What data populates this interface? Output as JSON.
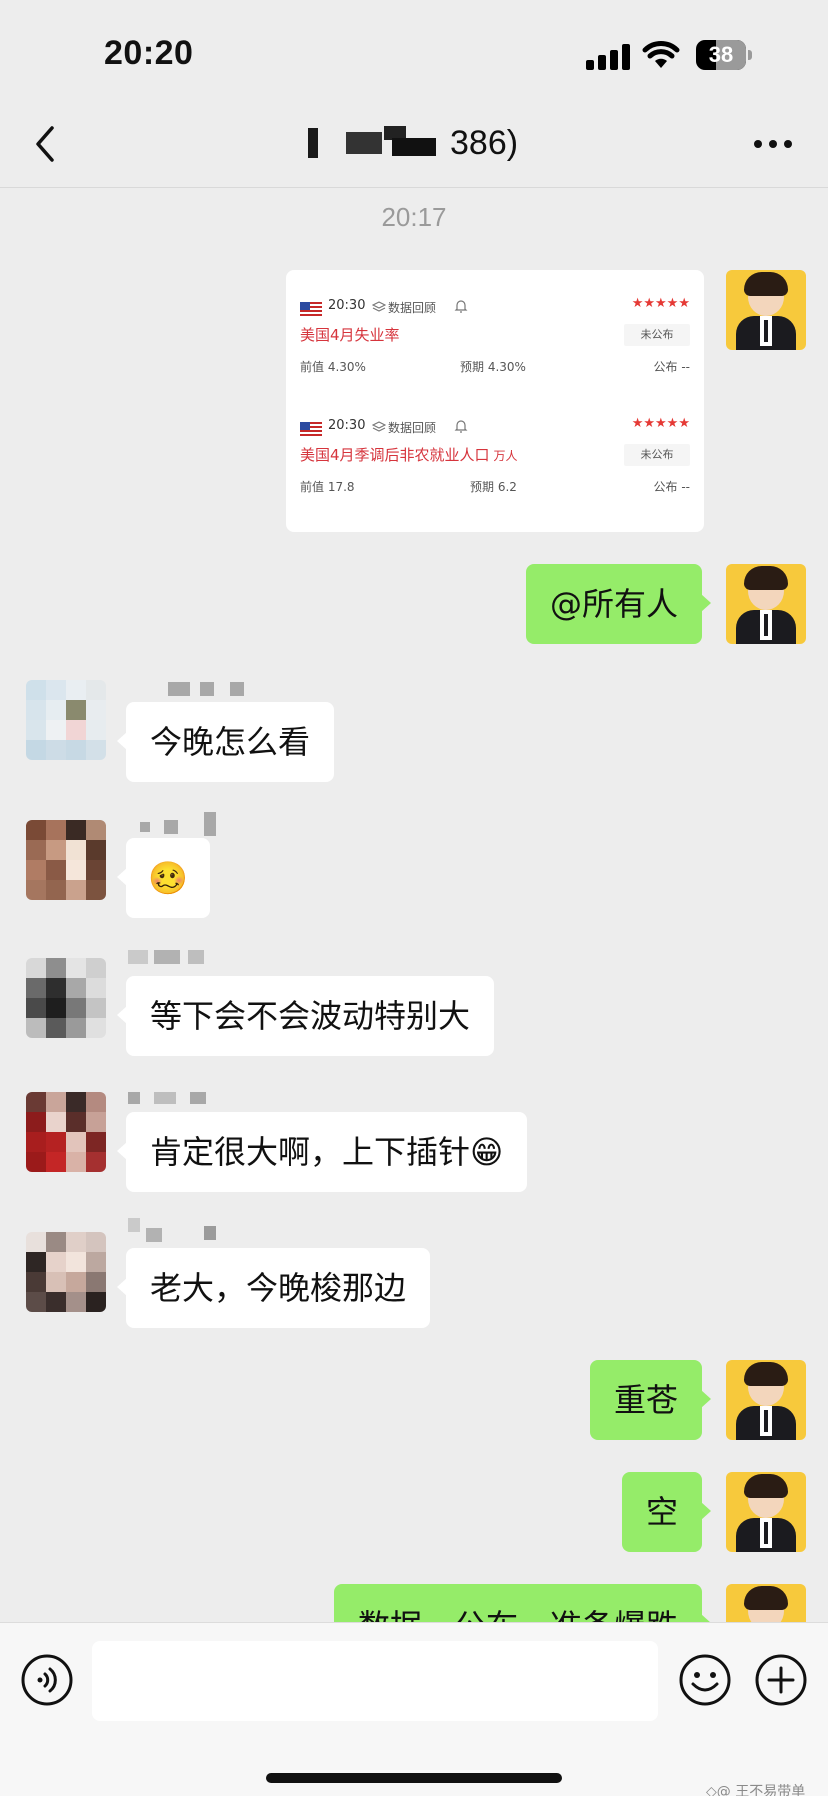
{
  "status_bar": {
    "time": "20:20",
    "battery": "38"
  },
  "nav": {
    "title_visible": "386)"
  },
  "chat": {
    "timestamp": "20:17",
    "data_card": {
      "items": [
        {
          "time": "20:30",
          "tag": "数据回顾",
          "stars": "★★★★★",
          "title": "美国4月失业率",
          "unit": "",
          "status": "未公布",
          "prev": "前值 4.30%",
          "forecast": "预期 4.30%",
          "published": "公布 --"
        },
        {
          "time": "20:30",
          "tag": "数据回顾",
          "stars": "★★★★★",
          "title": "美国4月季调后非农就业人口",
          "unit": "万人",
          "status": "未公布",
          "prev": "前值 17.8",
          "forecast": "预期 6.2",
          "published": "公布 --"
        }
      ]
    },
    "messages": {
      "m1": "@所有人",
      "m2": "今晚怎么看",
      "m3": "🥴",
      "m4": "等下会不会波动特别大",
      "m5": "肯定很大啊，上下插针😁",
      "m6": "老大，今晚梭那边",
      "m7": "重苍",
      "m8": "空",
      "m9": "数据一公布，准备爆跌"
    }
  },
  "input_bar": {
    "placeholder": ""
  },
  "watermark": "◇@ 王不易带单",
  "colors": {
    "bubble_self": "#95ec69",
    "bubble_other": "#ffffff",
    "background": "#ededed",
    "accent_red": "#d6343c"
  },
  "icons": [
    "back-icon",
    "more-icon",
    "voice-icon",
    "emoji-icon",
    "plus-icon",
    "bell-icon",
    "layers-icon",
    "us-flag-icon"
  ]
}
